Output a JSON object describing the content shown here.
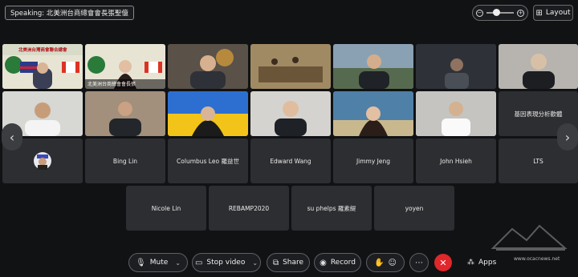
{
  "speaking": "Speaking: 北美洲台商總會會長張聖億",
  "layout_label": "Layout",
  "banner_text_1": "北美洲台灣商會聯合總會",
  "banner_text_2": "北美洲台商總會會長張",
  "participants_video": [
    {
      "label": ""
    },
    {
      "label": ""
    },
    {
      "label": ""
    },
    {
      "label": ""
    },
    {
      "label": ""
    },
    {
      "label": ""
    },
    {
      "label": ""
    }
  ],
  "name_tiles": [
    "基因表現分析歡體",
    "Bing Lin",
    "Columbus Leo 羅益世",
    "Edward Wang",
    "Jimmy Jeng",
    "John Hsieh",
    "LTS",
    "Nicole Lin",
    "REBAMP2020",
    "su phelps 羅素緹",
    "yoyen"
  ],
  "toolbar": {
    "mute": "Mute",
    "stop_video": "Stop video",
    "share": "Share",
    "record": "Record",
    "apps": "Apps"
  },
  "watermark_text": "www.ocacnews.net",
  "colors": {
    "end_call": "#e0272b",
    "tile_bg": "#2d2e31",
    "ukraine_blue": "#2d6fd1",
    "ukraine_yellow": "#f2c318"
  }
}
